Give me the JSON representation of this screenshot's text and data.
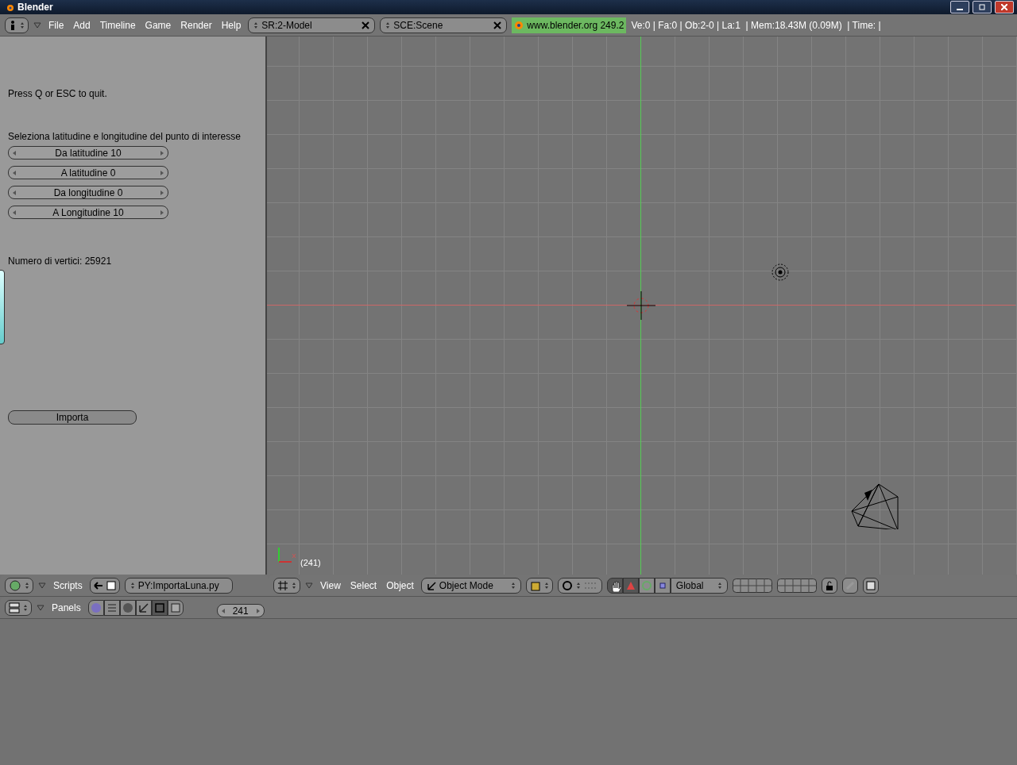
{
  "window": {
    "title": "Blender"
  },
  "menu": [
    "File",
    "Add",
    "Timeline",
    "Game",
    "Render",
    "Help"
  ],
  "screen_selector": {
    "value": "SR:2-Model"
  },
  "scene_selector": {
    "value": "SCE:Scene"
  },
  "version_badge": "www.blender.org 249.2",
  "stats": "Ve:0 | Fa:0 | Ob:2-0 | La:1  | Mem:18.43M (0.09M)  | Time: |",
  "script_panel": {
    "quit_hint": "Press Q or ESC to quit.",
    "prompt": "Seleziona latitudine e longitudine del punto di interesse",
    "number_fields": [
      "Da latitudine 10",
      "A latitudine 0",
      "Da longitudine 0",
      "A Longitudine 10"
    ],
    "vertex_count": "Numero di vertici: 25921",
    "import_button": "Importa"
  },
  "viewport": {
    "frame_label": "(241)"
  },
  "script_header": {
    "menu": "Scripts",
    "script_name": "PY:ImportaLuna.py"
  },
  "view_header": {
    "menus": [
      "View",
      "Select",
      "Object"
    ],
    "mode": "Object Mode",
    "manipulators": [
      {
        "kind": "hand",
        "selected": true
      },
      {
        "kind": "translate",
        "selected": true
      },
      {
        "kind": "rotate",
        "selected": false
      },
      {
        "kind": "scale",
        "selected": false
      }
    ],
    "orientation": "Global"
  },
  "buttons_header": {
    "menu": "Panels",
    "panel_tabs": [
      {
        "kind": "logic",
        "selected": false
      },
      {
        "kind": "script",
        "selected": false
      },
      {
        "kind": "shading",
        "selected": false
      },
      {
        "kind": "object",
        "selected": false
      },
      {
        "kind": "editing",
        "selected": true
      },
      {
        "kind": "scene",
        "selected": false
      }
    ],
    "frame": "241"
  }
}
